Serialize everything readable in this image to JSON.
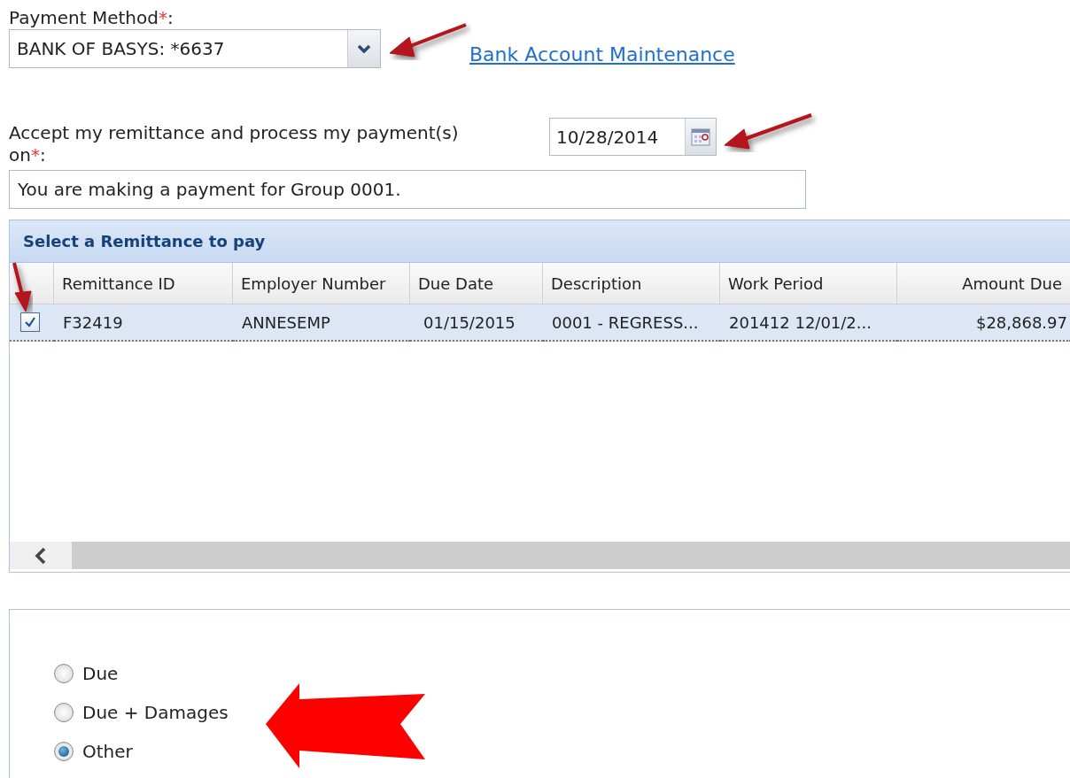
{
  "payment_method": {
    "label": "Payment Method",
    "required_mark": "*",
    "suffix": ":",
    "value": "BANK OF BASYS: *6637",
    "arrow_marked": true
  },
  "bank_link": "Bank Account Maintenance",
  "process_date": {
    "label": "Accept my remittance and process my payment(s) on",
    "required_mark": "*",
    "suffix": ":",
    "value": "10/28/2014",
    "arrow_marked": true
  },
  "info_message": "You are making a payment for Group 0001.",
  "remittance_grid": {
    "title": "Select a Remittance to pay",
    "columns": [
      "Remittance ID",
      "Employer Number",
      "Due Date",
      "Description",
      "Work Period",
      "Amount Due"
    ],
    "rows": [
      {
        "selected": true,
        "checked": true,
        "arrow_marked": true,
        "cells": [
          "F32419",
          "ANNESEMP",
          "01/15/2015",
          "0001 - REGRESS...",
          "201412 12/01/2...",
          "$28,868.97"
        ]
      }
    ]
  },
  "amount_options": {
    "block_arrow_marked": true,
    "options": [
      {
        "label": "Due",
        "selected": false
      },
      {
        "label": "Due + Damages",
        "selected": false
      },
      {
        "label": "Other",
        "selected": true
      }
    ]
  }
}
